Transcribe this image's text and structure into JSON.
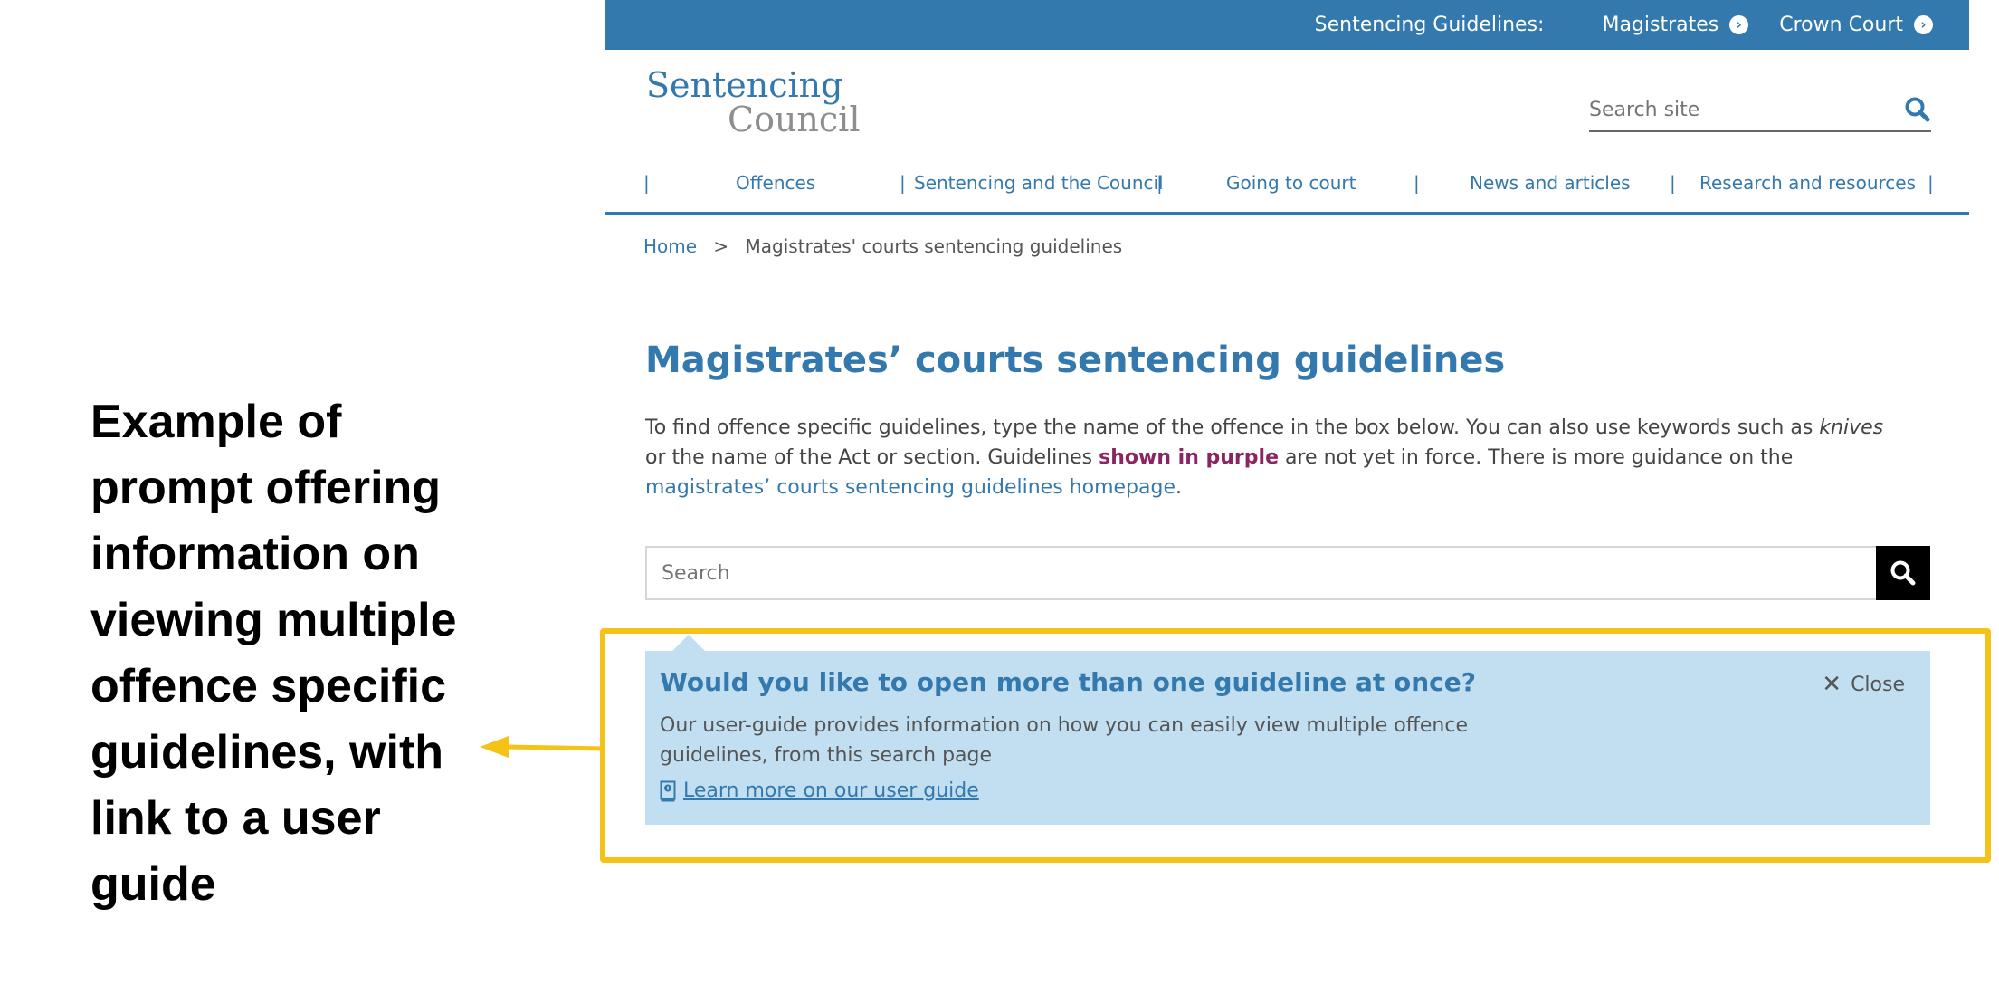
{
  "annotation": {
    "text": "Example of prompt offering information on viewing multiple offence specific guidelines, with link to a user guide",
    "highlight_color": "#f5c318"
  },
  "topbar": {
    "label": "Sentencing Guidelines:",
    "links": [
      {
        "label": "Magistrates",
        "icon": "chevron-right-circle-icon"
      },
      {
        "label": "Crown Court",
        "icon": "chevron-right-circle-icon"
      }
    ],
    "bg_color": "#3479ae"
  },
  "logo": {
    "line1": "Sentencing",
    "line2": "Council"
  },
  "site_search": {
    "placeholder": "Search site",
    "icon": "search-icon"
  },
  "nav": {
    "items": [
      {
        "label": "Offences"
      },
      {
        "label": "Sentencing and the Council"
      },
      {
        "label": "Going to court"
      },
      {
        "label": "News and articles"
      },
      {
        "label": "Research and resources"
      }
    ],
    "separator": "|"
  },
  "breadcrumb": {
    "home": "Home",
    "separator": ">",
    "current": "Magistrates' courts sentencing guidelines"
  },
  "main": {
    "title": "Magistrates’ courts sentencing guidelines",
    "intro": {
      "part1": "To find offence specific guidelines, type the name of the offence in the box below. You can also use keywords such as ",
      "keyword": "knives",
      "part2": " or the name of the Act or section. Guidelines ",
      "purple_text": "shown in purple",
      "part3": " are not yet in force. There is more guidance on the ",
      "link_text": "magistrates’ courts sentencing guidelines homepage",
      "part4": "."
    },
    "search": {
      "placeholder": "Search",
      "icon": "search-icon"
    }
  },
  "prompt": {
    "title": "Would you like to open more than one guideline at once?",
    "body": "Our user-guide provides  information on how  you can easily view multiple offence guidelines, from this search page",
    "link_label": "Learn more on our user guide",
    "link_icon": "user-guide-book-icon",
    "close_label": "Close",
    "close_icon": "close-icon",
    "bg_color": "#c1dff1"
  }
}
